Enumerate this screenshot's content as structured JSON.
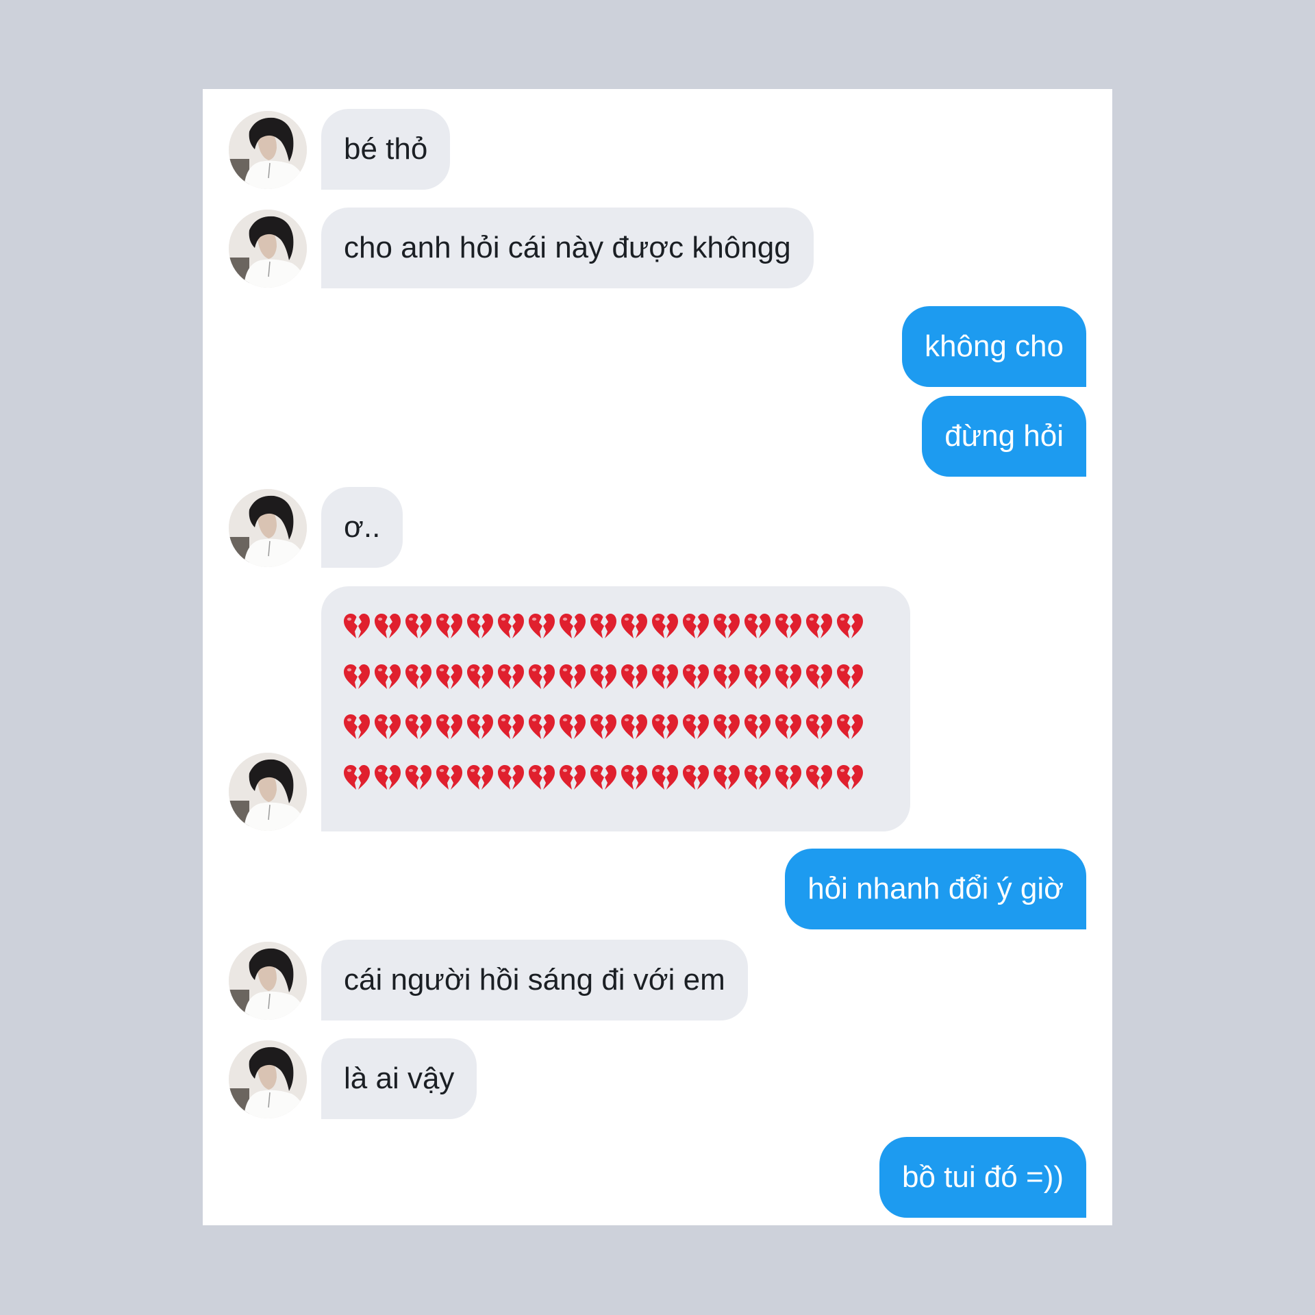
{
  "conversation": {
    "messages": [
      {
        "from": "them",
        "type": "text",
        "text": "bé thỏ"
      },
      {
        "from": "them",
        "type": "text",
        "text": "cho anh hỏi cái này được khôngg"
      },
      {
        "from": "me",
        "type": "text",
        "text": "không cho"
      },
      {
        "from": "me",
        "type": "text",
        "text": "đừng hỏi"
      },
      {
        "from": "them",
        "type": "text",
        "text": "ơ.."
      },
      {
        "from": "them",
        "type": "emoji",
        "emoji": "broken-heart",
        "rows": 4,
        "per_row": 17
      },
      {
        "from": "me",
        "type": "text",
        "text": "hỏi nhanh đổi ý giờ"
      },
      {
        "from": "them",
        "type": "text",
        "text": "cái người hồi sáng đi với em"
      },
      {
        "from": "them",
        "type": "text",
        "text": "là ai vậy"
      },
      {
        "from": "me",
        "type": "text",
        "text": "bồ tui đó =))"
      }
    ]
  },
  "colors": {
    "page_background": "#cdd1da",
    "card_background": "#ffffff",
    "incoming_bubble": "#e9ebf0",
    "outgoing_bubble": "#1d9bf0",
    "broken_heart": "#e0202e"
  },
  "icons": {
    "avatar": "profile-photo-avatar",
    "emoji": "broken-heart-icon"
  }
}
